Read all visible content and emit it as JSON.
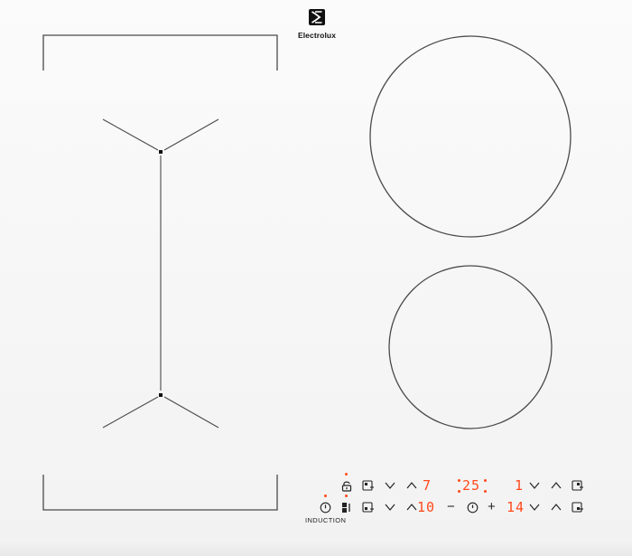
{
  "brand": {
    "name": "Electrolux",
    "logo_icon": "electrolux-logo-icon"
  },
  "cooktop": {
    "zones": [
      {
        "name": "bridge-zone-left",
        "shape": "flexible"
      },
      {
        "name": "large-round-zone",
        "shape": "circle"
      },
      {
        "name": "small-round-zone",
        "shape": "circle"
      }
    ]
  },
  "controls": {
    "label": "INDUCTION",
    "accent_color": "#ff4a1c",
    "icon_color": "#222222",
    "row_top": {
      "level_left": "7",
      "timer": "25",
      "level_right": "1"
    },
    "row_bottom": {
      "level_left": "10",
      "minus": "−",
      "plus": "+",
      "level_right": "14"
    }
  }
}
